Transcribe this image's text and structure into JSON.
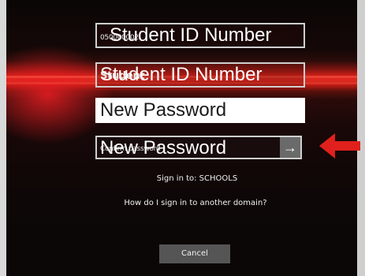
{
  "form": {
    "username": {
      "entered_value": "050000002",
      "overlay_label": "Student ID Number"
    },
    "confirm_username": {
      "entered_value": "Student",
      "overlay_label": "Student ID Number"
    },
    "new_password": {
      "overlay_label": "New Password"
    },
    "confirm_password": {
      "placeholder": "Confirm password",
      "overlay_label": "New Password",
      "submit_icon": "→"
    }
  },
  "info": {
    "sign_in_to": "Sign in to: SCHOOLS",
    "other_domain": "How do I sign in to another domain?"
  },
  "actions": {
    "cancel_label": "Cancel"
  },
  "annotation": {
    "arrow_color": "#e0201c"
  }
}
